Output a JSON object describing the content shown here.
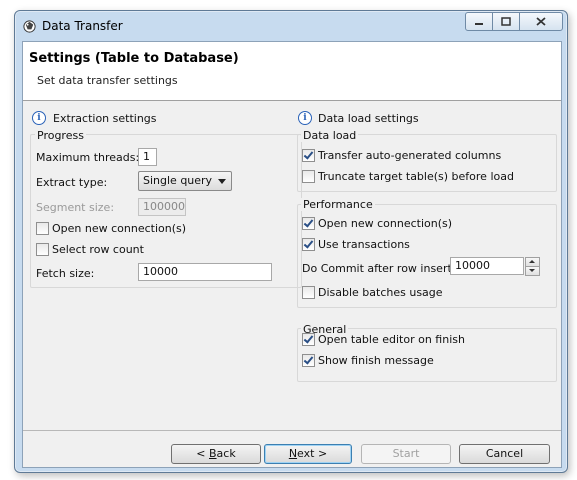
{
  "window": {
    "title": "Data Transfer"
  },
  "header": {
    "title": "Settings (Table to Database)",
    "subtitle": "Set data transfer settings"
  },
  "extraction": {
    "section_title": "Extraction settings",
    "progress_group": "Progress",
    "max_threads_label": "Maximum threads:",
    "max_threads_value": "1",
    "extract_type_label": "Extract type:",
    "extract_type_value": "Single query",
    "segment_size_label": "Segment size:",
    "segment_size_value": "100000",
    "open_new_connection": {
      "label": "Open new connection(s)",
      "checked": false
    },
    "select_row_count": {
      "label": "Select row count",
      "checked": false
    },
    "fetch_size_label": "Fetch size:",
    "fetch_size_value": "10000"
  },
  "data_load": {
    "section_title": "Data load settings",
    "data_load_group": "Data load",
    "transfer_auto_generated": {
      "label": "Transfer auto-generated columns",
      "checked": true
    },
    "truncate_target": {
      "label": "Truncate target table(s) before load",
      "checked": false
    },
    "performance_group": "Performance",
    "open_new_connection": {
      "label": "Open new connection(s)",
      "checked": true
    },
    "use_transactions": {
      "label": "Use transactions",
      "checked": true
    },
    "commit_label": "Do Commit after row insert:",
    "commit_value": "10000",
    "disable_batches": {
      "label": "Disable batches usage",
      "checked": false
    },
    "general_group": "General",
    "open_table_editor": {
      "label": "Open table editor on finish",
      "checked": true
    },
    "show_finish_message": {
      "label": "Show finish message",
      "checked": true
    }
  },
  "buttons": {
    "back_pre": "< ",
    "back_key": "B",
    "back_post": "ack",
    "next_key": "N",
    "next_post": "ext >",
    "start": "Start",
    "cancel": "Cancel"
  }
}
